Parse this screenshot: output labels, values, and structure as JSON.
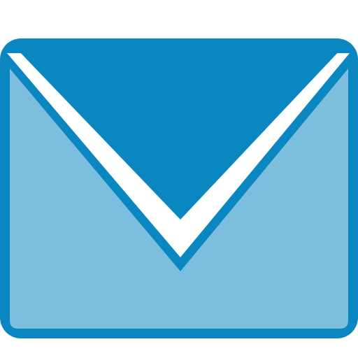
{
  "icon": {
    "name": "envelope-icon",
    "colors": {
      "outline": "#0a86c0",
      "flap": "#0a86c0",
      "body": "#7bbede",
      "gap": "#ffffff",
      "background": "#ffffff"
    }
  }
}
